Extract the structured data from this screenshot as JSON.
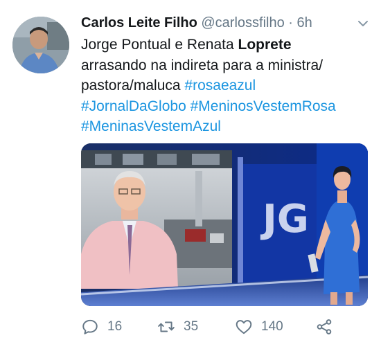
{
  "tweet": {
    "author_name": "Carlos Leite Filho",
    "handle": "@carlossfilho",
    "separator": "·",
    "time": "6h",
    "text_lines": [
      [
        "Jorge Pontual e Renata ",
        "Loprete"
      ],
      [
        "arrasando na indireta para a ministra/"
      ],
      [
        "pastora/maluca ",
        "#rosaeazul"
      ],
      [
        "#JornalDaGlobo",
        " ",
        "#MeninosVestemRosa"
      ],
      [
        "#MeninasVestemAzul"
      ]
    ]
  },
  "actions": {
    "reply_count": "16",
    "retweet_count": "35",
    "like_count": "140"
  },
  "colors": {
    "link": "#1b95e0",
    "muted": "#657786",
    "text": "#14171a"
  },
  "icons": [
    "chevron-down-icon",
    "reply-icon",
    "retweet-icon",
    "heart-icon",
    "share-icon"
  ]
}
